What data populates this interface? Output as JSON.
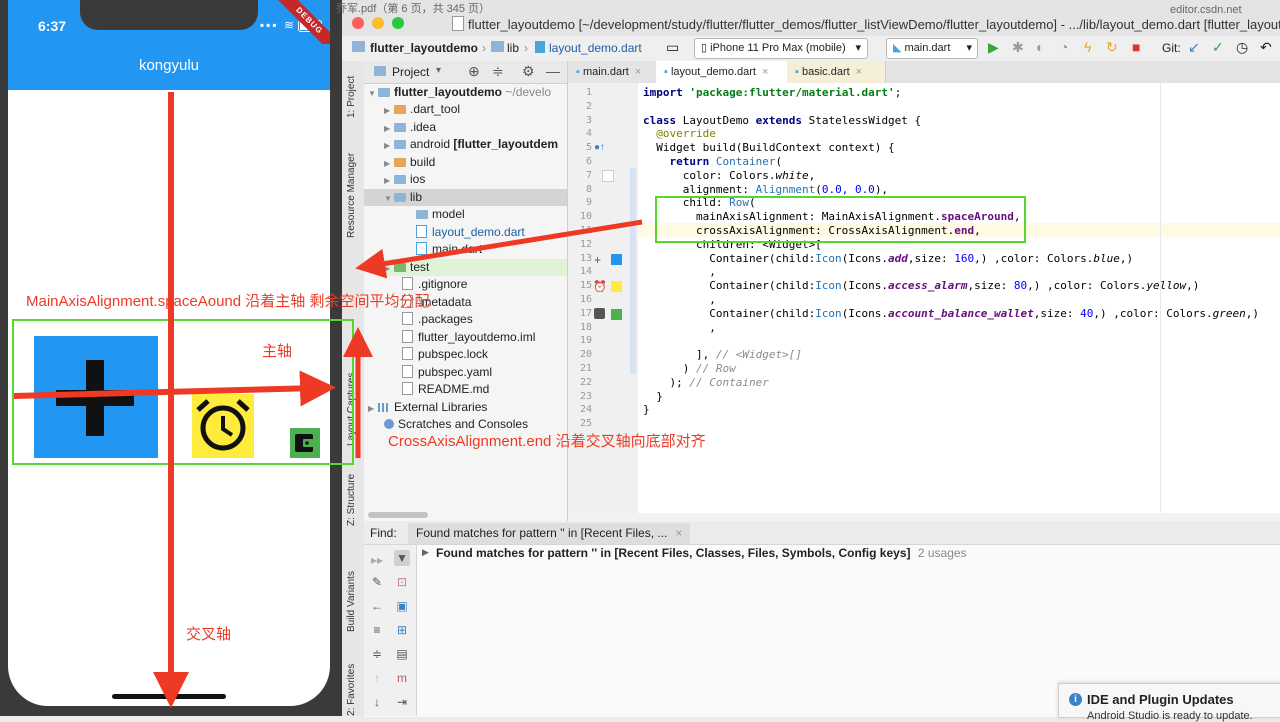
{
  "phone": {
    "time": "6:37",
    "status_icons": "▪▪▪ ≋",
    "debug_banner": "DEBUG",
    "appbar_title": "kongyulu"
  },
  "window": {
    "pdf_tab": "乔军.pdf（第 6 页，共 345 页）",
    "title": "flutter_layoutdemo [~/development/study/flutter/flutter_demos/flutter_listViewDemo/flutter_layoutdemo] - .../lib/layout_demo.dart [flutter_layoutdemo]",
    "browser_tab": "editor.csdn.net"
  },
  "toolbar": {
    "crumb_project": "flutter_layoutdemo",
    "crumb_lib": "lib",
    "crumb_file": "layout_demo.dart",
    "device": "iPhone 11 Pro Max (mobile)",
    "run_config": "main.dart",
    "git_label": "Git:"
  },
  "side_tabs": [
    "1: Project",
    "Resource Manager",
    "Layout Captures",
    "Z: Structure",
    "Build Variants",
    "2: Favorites"
  ],
  "project": {
    "header": "Project",
    "items": [
      {
        "label": "flutter_layoutdemo",
        "suffix": "~/develo"
      },
      {
        "label": ".dart_tool"
      },
      {
        "label": ".idea"
      },
      {
        "label": "android",
        "suffix": "[flutter_layoutdem"
      },
      {
        "label": "build"
      },
      {
        "label": "ios"
      },
      {
        "label": "lib"
      },
      {
        "label": "model"
      },
      {
        "label": "layout_demo.dart"
      },
      {
        "label": "main.dart"
      },
      {
        "label": "test"
      },
      {
        "label": ".gitignore"
      },
      {
        "label": ".metadata"
      },
      {
        "label": ".packages"
      },
      {
        "label": "flutter_layoutdemo.iml"
      },
      {
        "label": "pubspec.lock"
      },
      {
        "label": "pubspec.yaml"
      },
      {
        "label": "README.md"
      },
      {
        "label": "External Libraries"
      },
      {
        "label": "Scratches and Consoles"
      }
    ]
  },
  "editor": {
    "tabs": [
      "main.dart",
      "layout_demo.dart",
      "basic.dart"
    ],
    "line_numbers": [
      "1",
      "2",
      "3",
      "4",
      "5",
      "6",
      "7",
      "8",
      "9",
      "10",
      "11",
      "12",
      "13",
      "14",
      "15",
      "16",
      "17",
      "18",
      "19",
      "20",
      "21",
      "22",
      "23",
      "24",
      "25"
    ],
    "code": {
      "l1_kw": "import",
      "l1_str": "'package:flutter/material.dart'",
      "l1_end": ";",
      "l3_a": "class",
      "l3_b": " LayoutDemo ",
      "l3_c": "extends",
      "l3_d": " StatelessWidget {",
      "l4": "  @override",
      "l5": "  Widget build(BuildContext context) {",
      "l6_kw": "    return",
      "l6_cls": " Container",
      "l6_end": "(",
      "l7_a": "      color: Colors.",
      "l7_b": "white",
      "l7_c": ",",
      "l8_a": "      alignment: ",
      "l8_cls": "Alignment",
      "l8_b": "(",
      "l8_num": "0.0, 0.0",
      "l8_c": "),",
      "l9_a": "      child: ",
      "l9_cls": "Row",
      "l9_b": "(",
      "l10_a": "        mainAxisAlignment: MainAxisAlignment.",
      "l10_b": "spaceAround",
      "l10_c": ",",
      "l11_a": "        crossAxisAlignment: CrossAxisAlignment.",
      "l11_b": "end",
      "l11_c": ",",
      "l12": "        children: <Widget>[",
      "l13_a": "          Container(child:",
      "l13_cls": "Icon",
      "l13_b": "(Icons.",
      "l13_c": "add",
      "l13_d": ",size: ",
      "l13_num": "160",
      "l13_e": ",) ,color: Colors.",
      "l13_f": "blue",
      "l13_g": ",)",
      "l14": "          ,",
      "l15_a": "          Container(child:",
      "l15_cls": "Icon",
      "l15_b": "(Icons.",
      "l15_c": "access_alarm",
      "l15_d": ",size: ",
      "l15_num": "80",
      "l15_e": ",) ,color: Colors.",
      "l15_f": "yellow",
      "l15_g": ",)",
      "l16": "          ,",
      "l17_a": "          Container(child:",
      "l17_cls": "Icon",
      "l17_b": "(Icons.",
      "l17_c": "account_balance_wallet",
      "l17_d": ",size: ",
      "l17_num": "40",
      "l17_e": ",) ,color: Colors.",
      "l17_f": "green",
      "l17_g": ",)",
      "l18": "          ,",
      "l20_a": "        ], ",
      "l20_cmt": "// <Widget>[]",
      "l21_a": "      ) ",
      "l21_cmt": "// Row",
      "l22_a": "    ); ",
      "l22_cmt": "// Container",
      "l23": "  }",
      "l24": "}"
    }
  },
  "find": {
    "label": "Find:",
    "tab": "Found matches for pattern '' in [Recent Files, ...",
    "result": "Found matches for pattern '' in [Recent Files, Classes, Files, Symbols, Config keys]",
    "count": "2 usages"
  },
  "notification": {
    "title": "IDE and Plugin Updates",
    "body": "Android Studio is ready to update."
  },
  "annotations": {
    "main_axis_note": "MainAxisAlignment.spaceAound 沿着主轴 剩余空间平均分配",
    "main_axis": "主轴",
    "cross_axis_note": "CrossAxisAlignment.end 沿着交叉轴向底部对齐",
    "cross_axis": "交叉轴",
    "color": "#ee3a25",
    "box_color": "#59d531"
  },
  "colors": {
    "app_blue": "#2196f3",
    "yellow": "#ffeb3b",
    "green": "#4caf50"
  }
}
